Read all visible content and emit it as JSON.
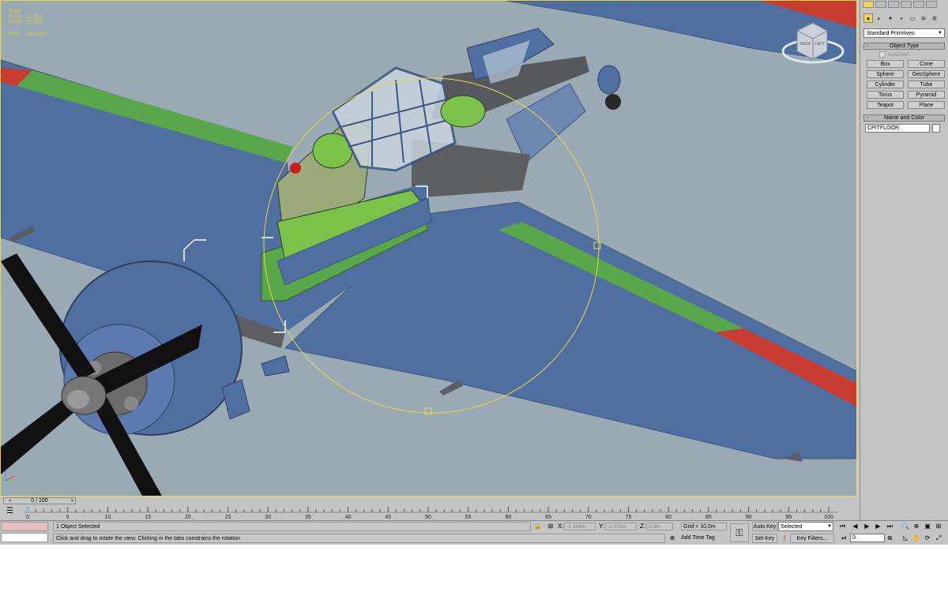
{
  "viewport": {
    "stats": [
      {
        "label": "Total",
        "value": ""
      },
      {
        "label": "Polys:",
        "value": "21,676"
      },
      {
        "label": "Verts:",
        "value": "20,294"
      },
      {
        "label": "FPS:",
        "value": "833.580"
      }
    ],
    "viewcube": {
      "back": "BACK",
      "left": "LEFT"
    },
    "colors": {
      "background": "#9aaab4",
      "fuselage": "#4f6fa0",
      "stripe_green": "#5aa64a",
      "stripe_red": "#c83c32",
      "selection": "#e8d84a"
    }
  },
  "command_panel": {
    "tabs": [
      "create-tab",
      "modify-tab",
      "hierarchy-tab",
      "motion-tab",
      "display-tab",
      "utilities-tab"
    ],
    "category_icons": [
      "geometry-icon",
      "shapes-icon",
      "lights-icon",
      "cameras-icon",
      "helpers-icon",
      "spacewarps-icon",
      "systems-icon"
    ],
    "primitives_dropdown": "Standard Primitives",
    "object_type": {
      "title": "Object Type",
      "autogrid": "AutoGrid",
      "buttons": [
        "Box",
        "Cone",
        "Sphere",
        "GeoSphere",
        "Cylinder",
        "Tube",
        "Torus",
        "Pyramid",
        "Teapot",
        "Plane"
      ]
    },
    "name_color": {
      "title": "Name and Color",
      "name": "CPITFLOOR",
      "swatch": "#ffffff"
    }
  },
  "time_slider": {
    "label": "0 / 100",
    "prev": "<",
    "next": ">"
  },
  "trackbar": {
    "ticks": [
      "0",
      "5",
      "10",
      "15",
      "20",
      "25",
      "30",
      "35",
      "40",
      "45",
      "50",
      "55",
      "60",
      "65",
      "70",
      "75",
      "80",
      "85",
      "90",
      "95",
      "100"
    ]
  },
  "status": {
    "selection": "1 Object Selected",
    "prompt": "Click and drag to rotate the view.  Clicking in the tabs constrains the rotation",
    "x_label": "X:",
    "x_value": "-2.424m",
    "y_label": "Y:",
    "y_value": "-2.072m",
    "z_label": "Z:",
    "z_value": "0.0m",
    "grid": "Grid = 10.0m",
    "add_time_tag": "Add Time Tag",
    "auto_key": "Auto Key",
    "set_key": "Set Key",
    "key_filters": "Key Filters...",
    "selected_dropdown": "Selected",
    "frame": "0"
  }
}
